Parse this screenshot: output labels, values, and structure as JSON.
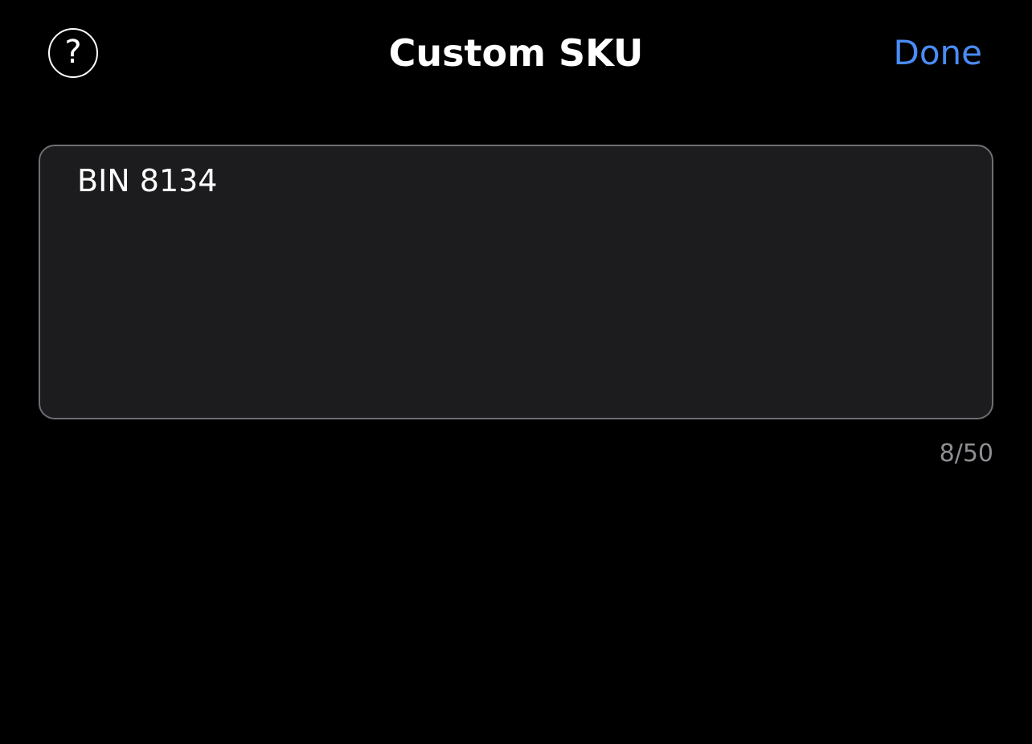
{
  "header": {
    "help_icon_glyph": "?",
    "help_icon": "question-circle-icon",
    "title": "Custom SKU",
    "done_label": "Done"
  },
  "sku_field": {
    "value": "BIN 8134",
    "char_count": "8/50"
  },
  "colors": {
    "background": "#000000",
    "accent": "#4a8cf7",
    "field_background": "#1c1c1e",
    "field_border": "#6e6e73",
    "counter_text": "#8e8e93"
  }
}
